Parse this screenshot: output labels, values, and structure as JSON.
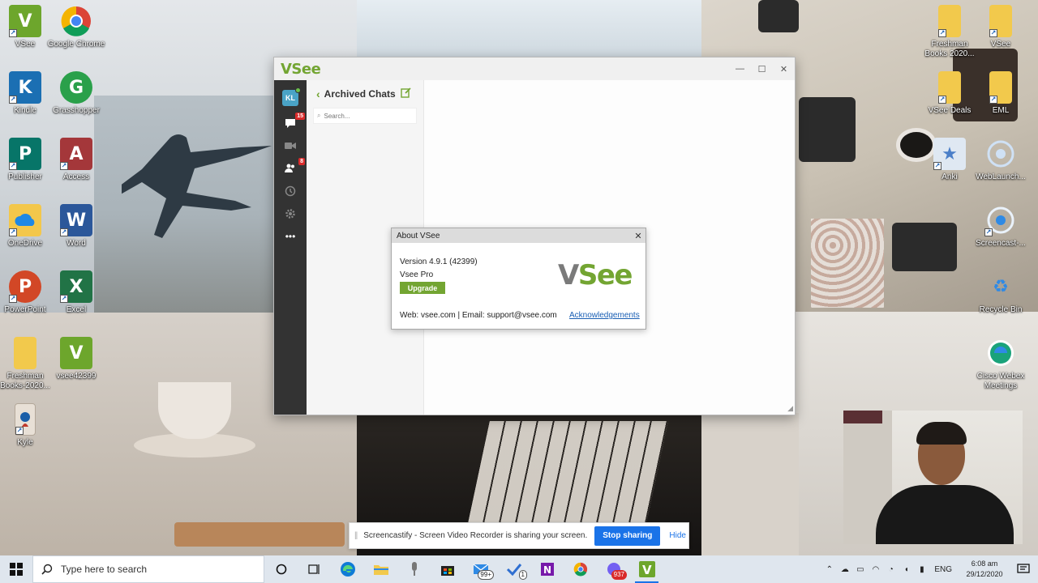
{
  "desktop_icons": [
    {
      "label": "VSee",
      "glyph": "V",
      "color": "#6da62c"
    },
    {
      "label": "Google Chrome",
      "glyph": "",
      "color": "#ffffff"
    },
    {
      "label": "Kindle",
      "glyph": "K",
      "color": "#1b6fb3"
    },
    {
      "label": "Grasshopper",
      "glyph": "G",
      "color": "#2aa04a"
    },
    {
      "label": "Publisher",
      "glyph": "P",
      "color": "#077568"
    },
    {
      "label": "Access",
      "glyph": "A",
      "color": "#a4373a"
    },
    {
      "label": "OneDrive",
      "glyph": "",
      "color": "#f3c74b"
    },
    {
      "label": "Word",
      "glyph": "W",
      "color": "#2b579a"
    },
    {
      "label": "PowerPoint",
      "glyph": "P",
      "color": "#d24726"
    },
    {
      "label": "Excel",
      "glyph": "X",
      "color": "#217346"
    },
    {
      "label": "Freshman Books-2020...",
      "glyph": "",
      "color": "#f2c94c"
    },
    {
      "label": "vsee42399",
      "glyph": "V",
      "color": "#6da62c"
    },
    {
      "label": "Kyle",
      "glyph": "",
      "color": "#e8e0d6"
    },
    {
      "label": "Freshman Books 2020...",
      "glyph": "",
      "color": "#f2c94c"
    },
    {
      "label": "VSee",
      "glyph": "",
      "color": "#f2c94c"
    },
    {
      "label": "VSee Deals",
      "glyph": "",
      "color": "#f2c94c"
    },
    {
      "label": "EML",
      "glyph": "",
      "color": "#f2c94c"
    },
    {
      "label": "Anki",
      "glyph": "★",
      "color": "#4b7fc8"
    },
    {
      "label": "WebLaunch...",
      "glyph": "",
      "color": "#dfe8f2"
    },
    {
      "label": "Screencast-...",
      "glyph": "",
      "color": "#dfe8f2"
    },
    {
      "label": "Recycle Bin",
      "glyph": "♻",
      "color": "#dfe8f2"
    },
    {
      "label": "Cisco Webex Meetings",
      "glyph": "",
      "color": "#1aa37a"
    }
  ],
  "vsee_window": {
    "logo": "VSee",
    "avatar_initials": "KL",
    "chat_badge": "15",
    "contacts_badge": "8",
    "panel_title": "Archived Chats",
    "search_placeholder": "Search..."
  },
  "about_dialog": {
    "title": "About VSee",
    "version": "Version 4.9.1 (42399)",
    "edition": "Vsee Pro",
    "upgrade_label": "Upgrade",
    "logo_v": "V",
    "logo_rest": "See",
    "contact": "Web: vsee.com | Email: support@vsee.com",
    "ack_link": "Acknowledgements"
  },
  "screencastify": {
    "message": "Screencastify - Screen Video Recorder is sharing your screen.",
    "stop_label": "Stop sharing",
    "hide_label": "Hide"
  },
  "taskbar": {
    "search_placeholder": "Type here to search",
    "mail_badge": "99+",
    "todo_badge": "1",
    "viber_badge": "937",
    "lang": "ENG",
    "time": "6:08 am",
    "date": "29/12/2020"
  },
  "colors": {
    "vsee_green": "#73a532",
    "rail": "#333333",
    "link_blue": "#1a73e8"
  }
}
